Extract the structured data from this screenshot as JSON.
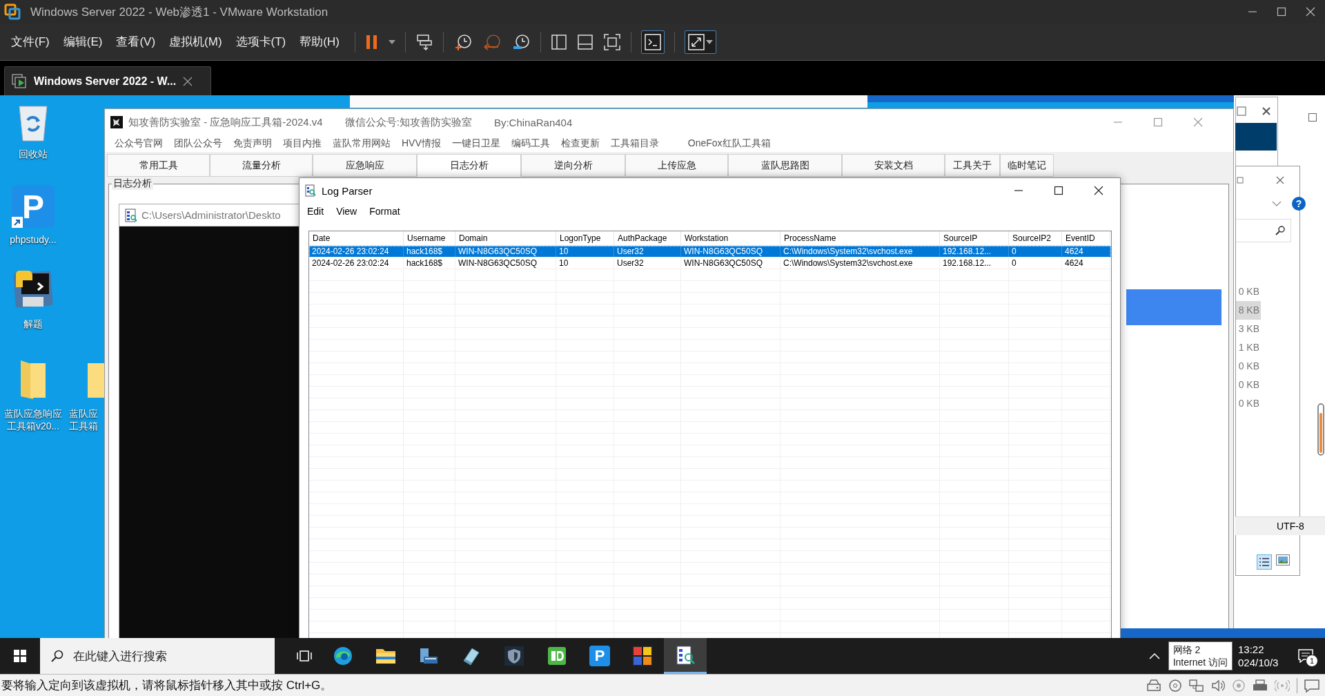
{
  "vmware": {
    "title": "Windows Server 2022 - Web渗透1 - VMware Workstation",
    "menu": [
      "文件(F)",
      "编辑(E)",
      "查看(V)",
      "虚拟机(M)",
      "选项卡(T)",
      "帮助(H)"
    ],
    "tab": "Windows Server 2022 - W...",
    "status": "要将输入定向到该虚拟机，请将鼠标指针移入其中或按 Ctrl+G。"
  },
  "desktop_icons": [
    {
      "kind": "recycle",
      "lines": [
        "回收站"
      ]
    },
    {
      "kind": "p-app",
      "glyph": "P",
      "lines": [
        "phpstudy..."
      ]
    },
    {
      "kind": "python",
      "lines": [
        "解题"
      ]
    },
    {
      "kind": "folder",
      "lines": [
        "蓝队应急响应",
        "工具箱v20..."
      ]
    },
    {
      "kind": "folder",
      "lines": [
        "蓝队应",
        "工具箱"
      ]
    }
  ],
  "toolbox": {
    "title": "知攻善防实验室 - 应急响应工具箱-2024.v4",
    "wechat": "微信公众号:知攻善防实验室",
    "author": "By:ChinaRan404",
    "menu": [
      "公众号官网",
      "团队公众号",
      "免责声明",
      "项目内推",
      "蓝队常用网站",
      "HVV情报",
      "一键日卫星",
      "编码工具",
      "检查更新",
      "工具箱目录",
      "OneFox红队工具箱"
    ],
    "tabs": [
      {
        "label": "常用工具",
        "selected": false
      },
      {
        "label": "流量分析",
        "selected": false
      },
      {
        "label": "应急响应",
        "selected": false
      },
      {
        "label": "日志分析",
        "selected": true
      },
      {
        "label": "逆向分析",
        "selected": false
      },
      {
        "label": "上传应急",
        "selected": false
      },
      {
        "label": "蓝队思路图",
        "selected": false
      },
      {
        "label": "安装文档",
        "selected": false
      },
      {
        "label": "工具关于",
        "selected": false
      },
      {
        "label": "临时笔记",
        "selected": false
      }
    ],
    "group": "日志分析",
    "path": "C:\\Users\\Administrator\\Deskto"
  },
  "log_parser": {
    "title": "Log Parser",
    "menu": [
      "Edit",
      "View",
      "Format"
    ],
    "columns": [
      "Date",
      "Username",
      "Domain",
      "LogonType",
      "AuthPackage",
      "Workstation",
      "ProcessName",
      "SourceIP",
      "SourceIP2",
      "EventID"
    ],
    "rows": [
      {
        "selected": true,
        "cells": [
          "2024-02-26 23:02:24",
          "hack168$",
          "WIN-N8G63QC50SQ",
          "10",
          "User32",
          "WIN-N8G63QC50SQ",
          "C:\\Windows\\System32\\svchost.exe",
          "192.168.12...",
          "0",
          "4624"
        ]
      },
      {
        "selected": false,
        "cells": [
          "2024-02-26 23:02:24",
          "hack168$",
          "WIN-N8G63QC50SQ",
          "10",
          "User32",
          "WIN-N8G63QC50SQ",
          "C:\\Windows\\System32\\svchost.exe",
          "192.168.12...",
          "0",
          "4624"
        ]
      }
    ]
  },
  "background_window": {
    "sizes": [
      {
        "text": "0 KB",
        "selected": false
      },
      {
        "text": "8 KB",
        "selected": true
      },
      {
        "text": "3 KB",
        "selected": false
      },
      {
        "text": "1 KB",
        "selected": false
      },
      {
        "text": "0 KB",
        "selected": false
      },
      {
        "text": "0 KB",
        "selected": false
      },
      {
        "text": "0 KB",
        "selected": false
      }
    ],
    "help": "?",
    "encoding": "UTF-8"
  },
  "taskbar": {
    "search_placeholder": "在此键入进行搜索",
    "apps": [
      {
        "kind": "browser",
        "selected": false
      },
      {
        "kind": "folder",
        "selected": false
      },
      {
        "kind": "server",
        "selected": false
      },
      {
        "kind": "book",
        "selected": false
      },
      {
        "kind": "shield",
        "selected": false
      },
      {
        "kind": "green",
        "selected": false
      },
      {
        "kind": "p-app",
        "glyph": "P",
        "selected": false
      },
      {
        "kind": "grid",
        "selected": false
      },
      {
        "kind": "log",
        "selected": true
      }
    ],
    "tooltip": [
      "网络 2",
      "Internet 访问"
    ],
    "time": "13:22",
    "date": "024/10/3",
    "notifications": "1"
  }
}
